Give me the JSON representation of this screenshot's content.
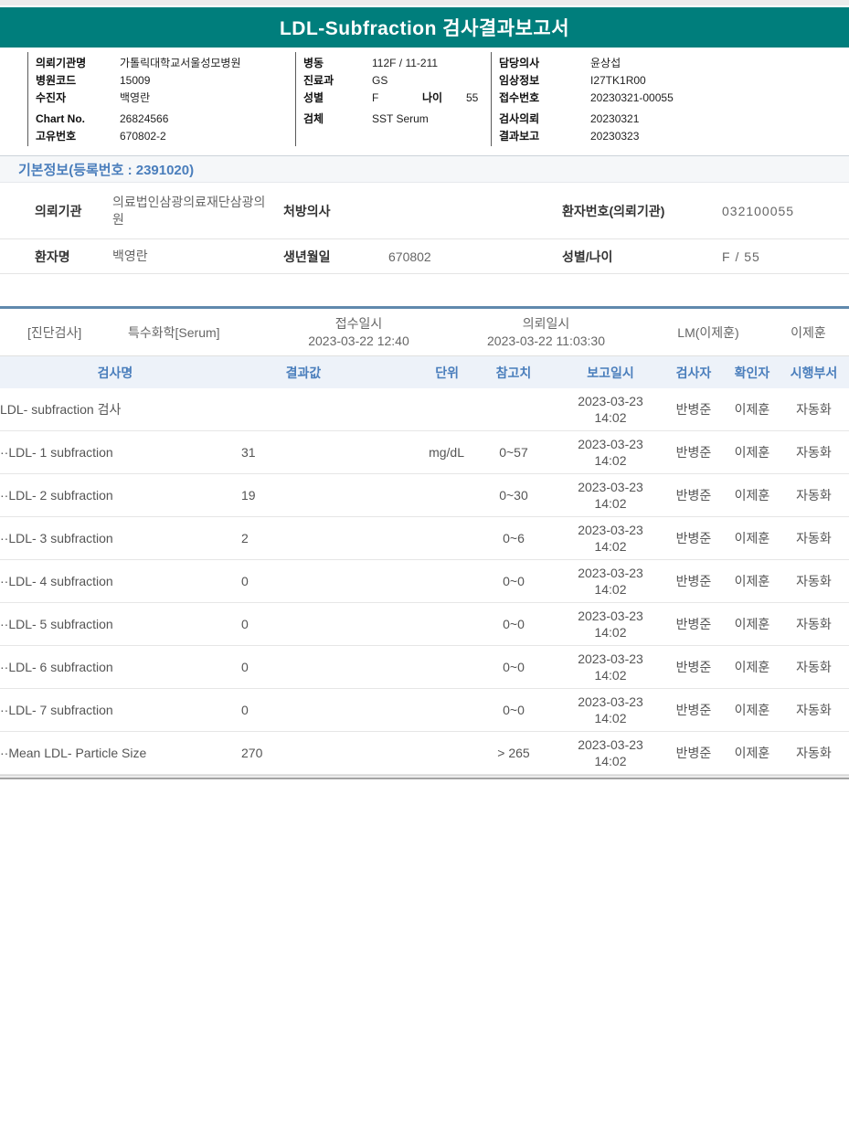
{
  "colors": {
    "teal": "#007e7c",
    "header_blue": "#4a7ebc",
    "divider_blue": "#6089ad"
  },
  "title_bar": {
    "title": "LDL-Subfraction 검사결과보고서"
  },
  "header_info": {
    "group1": {
      "rows": [
        {
          "label": "의뢰기관명",
          "value": "가톨릭대학교서울성모병원"
        },
        {
          "label": "병원코드",
          "value": "15009"
        },
        {
          "label": "수진자",
          "value": "백영란"
        },
        {
          "label": "Chart No.",
          "value": "26824566"
        },
        {
          "label": "고유번호",
          "value": "670802-2"
        }
      ]
    },
    "group2": {
      "rows": [
        {
          "label": "병동",
          "value": "112F / 11-211"
        },
        {
          "label": "진료과",
          "value": "GS"
        },
        {
          "label": "성별",
          "value": "F",
          "label2": "나이",
          "value2": "55"
        },
        {
          "label": "검체",
          "value": "SST Serum"
        }
      ]
    },
    "group3": {
      "rows": [
        {
          "label": "담당의사",
          "value": "윤상섭"
        },
        {
          "label": "임상정보",
          "value": "I27TK1R00"
        },
        {
          "label": "접수번호",
          "value": "20230321-00055"
        },
        {
          "label": "검사의뢰",
          "value": "20230321"
        },
        {
          "label": "결과보고",
          "value": "20230323"
        }
      ]
    }
  },
  "basic_info": {
    "section_title": "기본정보(등록번호 : 2391020)",
    "rows": [
      {
        "label1": "의뢰기관",
        "value1": "의료법인삼광의료재단삼광의원",
        "label2": "처방의사",
        "value2": "",
        "label3": "환자번호(의뢰기관)",
        "value3": "032100055"
      },
      {
        "label1": "환자명",
        "value1": "백영란",
        "label2": "생년월일",
        "value2": "670802",
        "label3": "성별/나이",
        "value3": "F / 55"
      }
    ]
  },
  "specimen_row": {
    "department": "[진단검사]",
    "test_group": "특수화학[Serum]",
    "receipt_label": "접수일시",
    "receipt_datetime": "2023-03-22 12:40",
    "request_label": "의뢰일시",
    "request_datetime": "2023-03-22 11:03:30",
    "lm": "LM(이제훈)",
    "reviewer": "이제훈"
  },
  "results": {
    "columns": [
      "검사명",
      "결과값",
      "단위",
      "참고치",
      "보고일시",
      "검사자",
      "확인자",
      "시행부서"
    ],
    "rows": [
      {
        "name": "LDL- subfraction 검사",
        "result": "",
        "unit": "",
        "ref": "",
        "date": "2023-03-23",
        "time": "14:02",
        "tester": "반병준",
        "confirmer": "이제훈",
        "dept": "자동화"
      },
      {
        "name": "··LDL- 1 subfraction",
        "result": "31",
        "unit": "mg/dL",
        "ref": "0~57",
        "date": "2023-03-23",
        "time": "14:02",
        "tester": "반병준",
        "confirmer": "이제훈",
        "dept": "자동화"
      },
      {
        "name": "··LDL- 2 subfraction",
        "result": "19",
        "unit": "",
        "ref": "0~30",
        "date": "2023-03-23",
        "time": "14:02",
        "tester": "반병준",
        "confirmer": "이제훈",
        "dept": "자동화"
      },
      {
        "name": "··LDL- 3 subfraction",
        "result": "2",
        "unit": "",
        "ref": "0~6",
        "date": "2023-03-23",
        "time": "14:02",
        "tester": "반병준",
        "confirmer": "이제훈",
        "dept": "자동화"
      },
      {
        "name": "··LDL- 4 subfraction",
        "result": "0",
        "unit": "",
        "ref": "0~0",
        "date": "2023-03-23",
        "time": "14:02",
        "tester": "반병준",
        "confirmer": "이제훈",
        "dept": "자동화"
      },
      {
        "name": "··LDL- 5 subfraction",
        "result": "0",
        "unit": "",
        "ref": "0~0",
        "date": "2023-03-23",
        "time": "14:02",
        "tester": "반병준",
        "confirmer": "이제훈",
        "dept": "자동화"
      },
      {
        "name": "··LDL- 6 subfraction",
        "result": "0",
        "unit": "",
        "ref": "0~0",
        "date": "2023-03-23",
        "time": "14:02",
        "tester": "반병준",
        "confirmer": "이제훈",
        "dept": "자동화"
      },
      {
        "name": "··LDL- 7 subfraction",
        "result": "0",
        "unit": "",
        "ref": "0~0",
        "date": "2023-03-23",
        "time": "14:02",
        "tester": "반병준",
        "confirmer": "이제훈",
        "dept": "자동화"
      },
      {
        "name": "··Mean LDL- Particle Size",
        "result": "270",
        "unit": "",
        "ref": "> 265",
        "date": "2023-03-23",
        "time": "14:02",
        "tester": "반병준",
        "confirmer": "이제훈",
        "dept": "자동화"
      }
    ]
  }
}
